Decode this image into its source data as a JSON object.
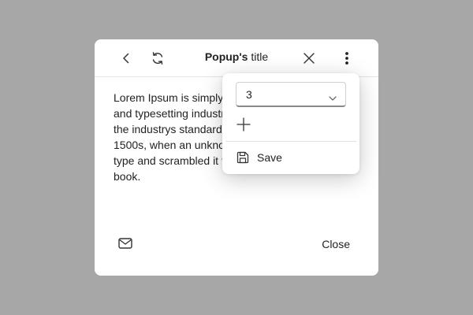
{
  "popup": {
    "title_bold": "Popup's",
    "title_rest": "title",
    "body": "Lorem Ipsum is simply dummy text of the printing and typesetting industry. Lorem Ipsum has been the industrys standard dummy text ever since the 1500s, when an unknown printer took a galley of type and scrambled it to make a type specimen book.",
    "close_label": "Close"
  },
  "icons": {
    "back": "chevron-left-icon",
    "refresh": "refresh-icon",
    "close": "close-icon",
    "more": "more-vertical-icon",
    "mail": "mail-icon",
    "add": "plus-icon",
    "save": "floppy-disk-icon",
    "dropdown": "chevron-down-icon"
  },
  "menu": {
    "select_value": "3",
    "save_label": "Save"
  },
  "colors": {
    "backdrop": "#a7a7a7",
    "surface": "#ffffff",
    "text": "#222222"
  }
}
